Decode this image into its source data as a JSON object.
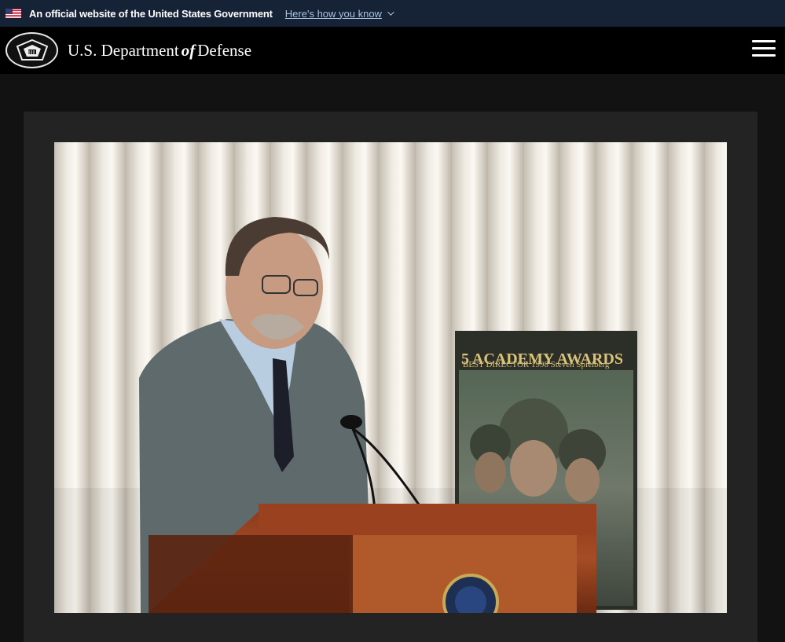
{
  "gov_banner": {
    "official_text": "An official website of the United States Government",
    "how_you_know_link": "Here's how you know"
  },
  "header": {
    "title_pre": "U.S. Department",
    "title_of": "of",
    "title_post": "Defense"
  },
  "photo": {
    "poster_line1": "5 ACADEMY AWARDS",
    "poster_line2": "BEST DIRECTOR 1998 Steven Spielberg"
  },
  "colors": {
    "banner_bg": "#162236",
    "header_bg": "#000000",
    "page_bg": "#121212",
    "panel_bg": "#232323",
    "link": "#a8c2e0"
  }
}
